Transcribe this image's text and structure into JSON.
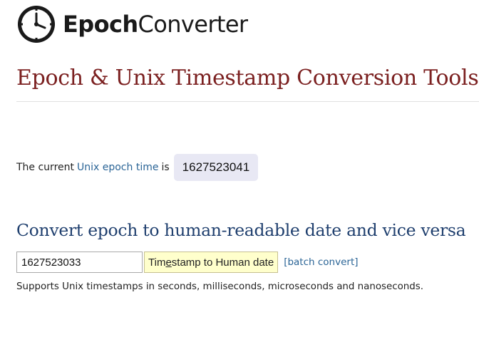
{
  "brand": {
    "name_bold": "Epoch",
    "name_regular": "Converter",
    "logo_icon": "clock-icon"
  },
  "page_title": "Epoch & Unix Timestamp Conversion Tools",
  "current_time": {
    "prefix": "The current",
    "link_text": "Unix epoch time",
    "suffix": "is",
    "value": "1627523041"
  },
  "converter": {
    "heading": "Convert epoch to human-readable date and vice versa",
    "input_value": "1627523033",
    "button_label_pre": "Tim",
    "button_label_underlined": "e",
    "button_label_post": "stamp to Human date",
    "batch_link": "[batch convert]",
    "supports_text": "Supports Unix timestamps in seconds, milliseconds, microseconds and nanoseconds."
  },
  "colors": {
    "title": "#7b2020",
    "heading": "#1f3f6e",
    "link": "#2a6496",
    "button_bg": "#ffffcc",
    "epoch_box_bg": "#e8e8f4"
  }
}
